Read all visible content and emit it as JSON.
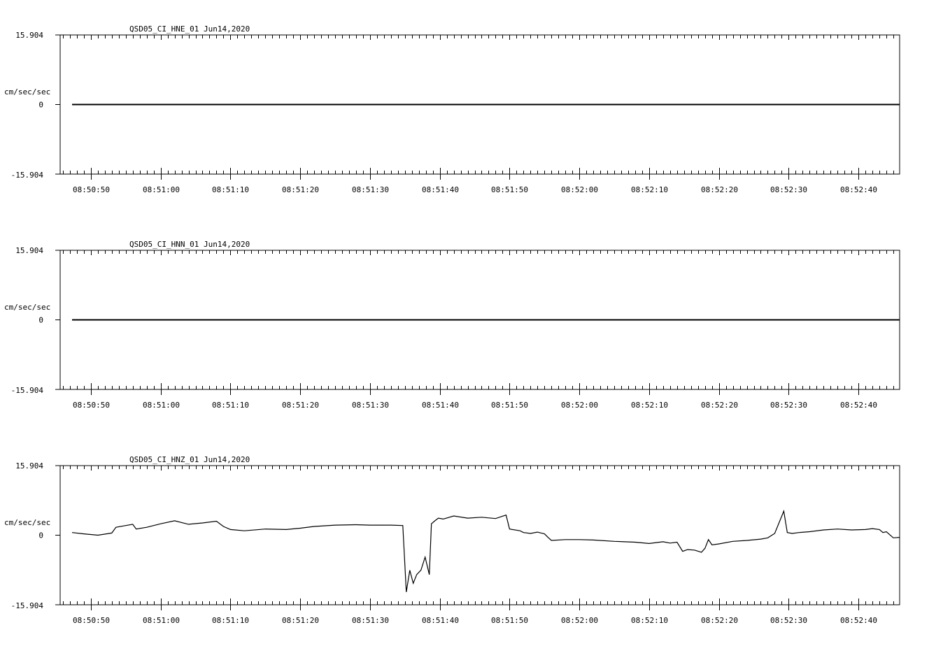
{
  "chart_data": [
    {
      "type": "line",
      "title": "QSD05_CI_HNE_01  Jun14,2020",
      "ylabel": "cm/sec/sec",
      "ylim": [
        -15.904,
        15.904
      ],
      "ytick_labels": [
        "15.904",
        "0",
        "-15.904"
      ],
      "x_tick_labels": [
        "08:50:50",
        "08:51:00",
        "08:51:10",
        "08:51:20",
        "08:51:30",
        "08:51:40",
        "08:51:50",
        "08:52:00",
        "08:52:10",
        "08:52:20",
        "08:52:30",
        "08:52:40"
      ],
      "x_range_seconds": [
        45.6,
        165.9
      ],
      "series": [
        {
          "x": [
            47.3,
            165.9
          ],
          "values": [
            0.0,
            0.0
          ]
        }
      ]
    },
    {
      "type": "line",
      "title": "QSD05_CI_HNN_01  Jun14,2020",
      "ylabel": "cm/sec/sec",
      "ylim": [
        -15.904,
        15.904
      ],
      "ytick_labels": [
        "15.904",
        "0",
        "-15.904"
      ],
      "x_tick_labels": [
        "08:50:50",
        "08:51:00",
        "08:51:10",
        "08:51:20",
        "08:51:30",
        "08:51:40",
        "08:51:50",
        "08:52:00",
        "08:52:10",
        "08:52:20",
        "08:52:30",
        "08:52:40"
      ],
      "x_range_seconds": [
        45.6,
        165.9
      ],
      "series": [
        {
          "x": [
            47.3,
            165.9
          ],
          "values": [
            0.0,
            0.0
          ]
        }
      ]
    },
    {
      "type": "line",
      "title": "QSD05_CI_HNZ_01  Jun14,2020",
      "ylabel": "cm/sec/sec",
      "ylim": [
        -15.904,
        15.904
      ],
      "ytick_labels": [
        "15.904",
        "0",
        "-15.904"
      ],
      "x_tick_labels": [
        "08:50:50",
        "08:51:00",
        "08:51:10",
        "08:51:20",
        "08:51:30",
        "08:51:40",
        "08:51:50",
        "08:52:00",
        "08:52:10",
        "08:52:20",
        "08:52:30",
        "08:52:40"
      ],
      "x_range_seconds": [
        45.6,
        165.9
      ],
      "series": [
        {
          "x": [
            47.3,
            49.0,
            51.0,
            53.0,
            53.6,
            55.0,
            56.0,
            56.5,
            58.0,
            60.0,
            62.0,
            64.0,
            66.0,
            68.0,
            69.0,
            70.0,
            72.0,
            75.0,
            78.0,
            80.0,
            82.0,
            85.0,
            88.0,
            90.0,
            93.0,
            94.7,
            95.2,
            95.7,
            96.2,
            96.7,
            97.3,
            97.9,
            98.5,
            98.8,
            99.3,
            99.8,
            100.5,
            102.0,
            104.0,
            106.0,
            108.0,
            109.5,
            110.0,
            111.5,
            112.0,
            113.0,
            114.0,
            115.0,
            115.5,
            116.0,
            118.0,
            120.0,
            122.0,
            125.0,
            128.0,
            130.0,
            132.0,
            133.0,
            134.0,
            134.8,
            135.5,
            136.5,
            137.5,
            138.0,
            138.5,
            139.0,
            140.0,
            142.0,
            144.0,
            146.0,
            147.0,
            148.0,
            149.3,
            149.8,
            150.5,
            151.5,
            153.0,
            155.0,
            157.0,
            159.0,
            161.0,
            162.0,
            163.0,
            163.5,
            164.0,
            165.0,
            165.9
          ],
          "values": [
            0.6,
            0.3,
            0.0,
            0.5,
            1.8,
            2.2,
            2.5,
            1.4,
            1.8,
            2.6,
            3.3,
            2.5,
            2.8,
            3.2,
            2.0,
            1.3,
            1.0,
            1.4,
            1.3,
            1.6,
            2.0,
            2.3,
            2.4,
            2.3,
            2.3,
            2.2,
            -13.0,
            -8.0,
            -11.0,
            -9.0,
            -8.0,
            -5.0,
            -9.0,
            2.6,
            3.3,
            3.9,
            3.7,
            4.4,
            3.9,
            4.1,
            3.8,
            4.6,
            1.4,
            1.0,
            0.6,
            0.4,
            0.7,
            0.3,
            -0.5,
            -1.2,
            -1.0,
            -1.0,
            -1.1,
            -1.4,
            -1.6,
            -1.9,
            -1.5,
            -1.8,
            -1.6,
            -3.7,
            -3.3,
            -3.4,
            -3.9,
            -3.0,
            -1.0,
            -2.2,
            -2.0,
            -1.4,
            -1.2,
            -0.9,
            -0.6,
            0.4,
            5.5,
            0.6,
            0.4,
            0.6,
            0.8,
            1.2,
            1.4,
            1.2,
            1.3,
            1.5,
            1.3,
            0.6,
            0.8,
            -0.6,
            -0.5
          ]
        }
      ]
    }
  ]
}
